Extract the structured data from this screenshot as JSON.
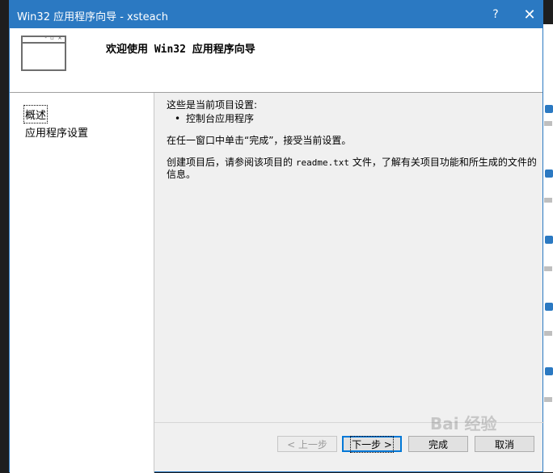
{
  "window": {
    "title": "Win32 应用程序向导 - xsteach",
    "help_label": "?",
    "close_label": "✕"
  },
  "header": {
    "title": "欢迎使用 Win32 应用程序向导",
    "icon": "wizard-window-icon"
  },
  "nav": {
    "items": [
      "概述",
      "应用程序设置"
    ]
  },
  "content": {
    "intro": "这些是当前项目设置:",
    "setting_bullet": "控制台应用程序",
    "line2": "在任一窗口中单击“完成”，接受当前设置。",
    "line3_part1": "创建项目后，请参阅该项目的 ",
    "line3_mono": "readme.txt",
    "line3_part2": " 文件，了解有关项目功能和所生成的文件的信息。"
  },
  "buttons": {
    "back": "< 上一步",
    "next": "下一步 >",
    "finish": "完成",
    "cancel": "取消"
  },
  "watermark": "Bai 经验"
}
